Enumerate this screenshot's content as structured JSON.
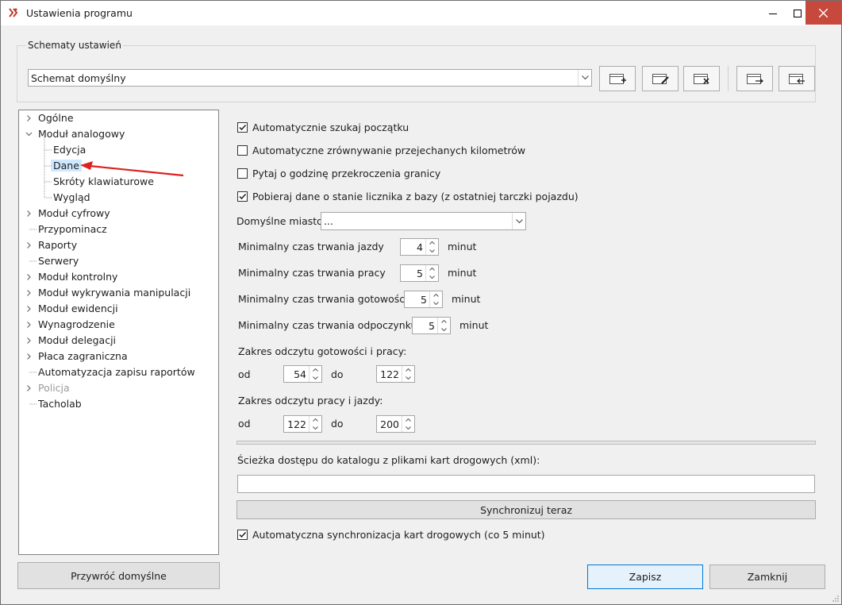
{
  "window": {
    "title": "Ustawienia programu",
    "controls": [
      "minimize-icon",
      "maximize-icon",
      "close-icon"
    ],
    "close_color": "#c7493d"
  },
  "schemes": {
    "group_label": "Schematy ustawień",
    "selected": "Schemat domyślny",
    "toolbar_icons": [
      "add-scheme-icon",
      "edit-scheme-icon",
      "delete-scheme-icon",
      "export-scheme-icon",
      "import-scheme-icon"
    ]
  },
  "tree": {
    "items": [
      {
        "label": "Ogólne",
        "expandable": true,
        "expanded": false
      },
      {
        "label": "Moduł analogowy",
        "expandable": true,
        "expanded": true
      },
      {
        "label": "Edycja"
      },
      {
        "label": "Dane",
        "selected": true
      },
      {
        "label": "Skróty klawiaturowe"
      },
      {
        "label": "Wygląd"
      },
      {
        "label": "Moduł cyfrowy",
        "expandable": true
      },
      {
        "label": "Przypominacz"
      },
      {
        "label": "Raporty",
        "expandable": true
      },
      {
        "label": "Serwery"
      },
      {
        "label": "Moduł kontrolny",
        "expandable": true
      },
      {
        "label": "Moduł wykrywania manipulacji",
        "expandable": true
      },
      {
        "label": "Moduł ewidencji",
        "expandable": true
      },
      {
        "label": "Wynagrodzenie",
        "expandable": true
      },
      {
        "label": "Moduł delegacji",
        "expandable": true
      },
      {
        "label": "Płaca zagraniczna",
        "expandable": true
      },
      {
        "label": "Automatyzacja zapisu raportów"
      },
      {
        "label": "Policja",
        "expandable": true,
        "disabled": true
      },
      {
        "label": "Tacholab"
      }
    ],
    "annotation_arrow_color": "#e02020"
  },
  "settings": {
    "checkboxes": [
      {
        "label": "Automatycznie szukaj początku",
        "checked": true
      },
      {
        "label": "Automatyczne zrównywanie przejechanych kilometrów",
        "checked": false
      },
      {
        "label": "Pytaj o godzinę przekroczenia granicy",
        "checked": false
      },
      {
        "label": "Pobieraj dane o stanie licznika z bazy (z ostatniej tarczki pojazdu)",
        "checked": true
      }
    ],
    "city": {
      "label": "Domyślne miasto",
      "value": "..."
    },
    "min_times": [
      {
        "label": "Minimalny czas trwania jazdy",
        "value": "4",
        "unit": "minut"
      },
      {
        "label": "Minimalny czas trwania pracy",
        "value": "5",
        "unit": "minut"
      },
      {
        "label": "Minimalny czas trwania gotowości",
        "value": "5",
        "unit": "minut"
      },
      {
        "label": "Minimalny czas trwania odpoczynku",
        "value": "5",
        "unit": "minut"
      }
    ],
    "range_ready": {
      "label": "Zakres odczytu gotowości i pracy:",
      "from_label": "od",
      "from": "54",
      "to_label": "do",
      "to": "122"
    },
    "range_drive": {
      "label": "Zakres odczytu pracy i jazdy:",
      "from_label": "od",
      "from": "122",
      "to_label": "do",
      "to": "200"
    },
    "path_label": "Ścieżka dostępu do katalogu z plikami kart drogowych (xml):",
    "path_value": "",
    "sync_button": "Synchronizuj teraz",
    "auto_sync": {
      "label": "Automatyczna synchronizacja kart drogowych (co 5 minut)",
      "checked": true
    }
  },
  "footer": {
    "restore_button": "Przywróć domyślne",
    "save_button": "Zapisz",
    "close_button": "Zamknij"
  }
}
